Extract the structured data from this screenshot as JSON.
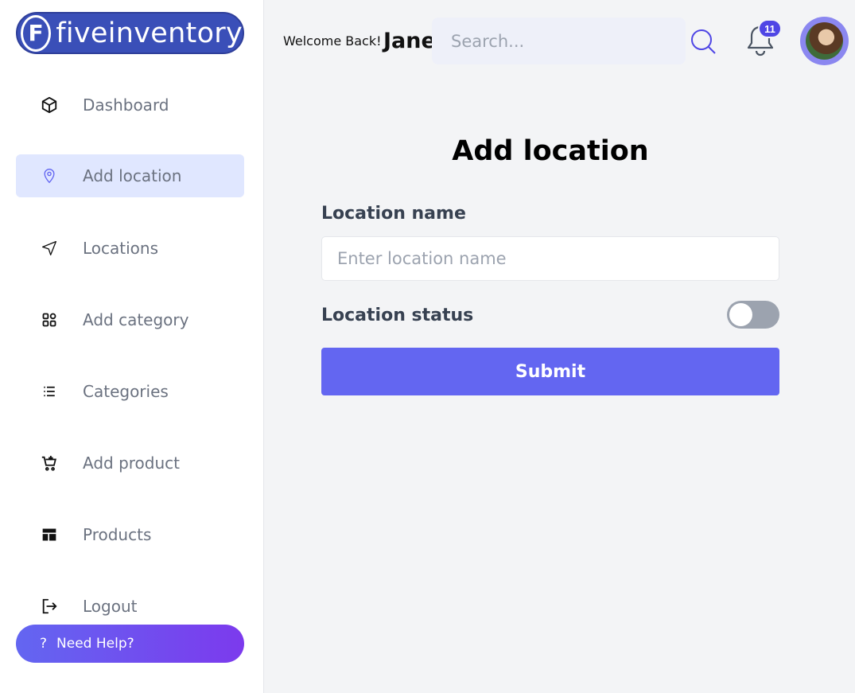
{
  "brand": {
    "logo_letter": "F",
    "name": "fiveinventory"
  },
  "sidebar": {
    "items": [
      {
        "label": "Dashboard",
        "icon": "cube-icon",
        "active": false
      },
      {
        "label": "Add location",
        "icon": "map-pin-icon",
        "active": true
      },
      {
        "label": "Locations",
        "icon": "navigation-arrow-icon",
        "active": false
      },
      {
        "label": "Add category",
        "icon": "grid-add-icon",
        "active": false
      },
      {
        "label": "Categories",
        "icon": "list-icon",
        "active": false
      },
      {
        "label": "Add product",
        "icon": "cart-add-icon",
        "active": false
      },
      {
        "label": "Products",
        "icon": "layout-icon",
        "active": false
      },
      {
        "label": "Logout",
        "icon": "logout-icon",
        "active": false
      }
    ],
    "help": {
      "icon": "?",
      "label": "Need Help?"
    }
  },
  "header": {
    "welcome": "Welcome Back!",
    "username": "Jane",
    "search_placeholder": "Search...",
    "notification_count": "11"
  },
  "form": {
    "title": "Add location",
    "name_label": "Location name",
    "name_placeholder": "Enter location name",
    "name_value": "",
    "status_label": "Location status",
    "status_on": false,
    "submit_label": "Submit"
  },
  "colors": {
    "accent": "#6366f1",
    "active_bg": "#e0e7ff",
    "logo_bg": "#3a4fb8",
    "badge": "#4f46e5"
  }
}
